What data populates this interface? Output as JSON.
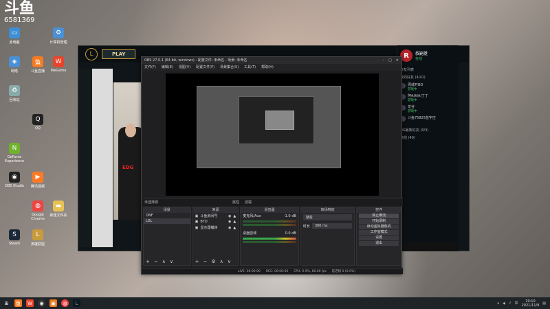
{
  "watermark": {
    "logo": "斗鱼",
    "room": "6581369"
  },
  "desktop_icons": [
    {
      "label": "此电脑",
      "icon": "computer-icon",
      "color": "#3f8fd6",
      "glyph": "▭"
    },
    {
      "label": "计算机管理",
      "icon": "gear-icon",
      "color": "#4a90d6",
      "glyph": "⚙"
    },
    {
      "label": "网络",
      "icon": "network-icon",
      "color": "#4a90d6",
      "glyph": "◈"
    },
    {
      "label": "斗鱼直播",
      "icon": "douyu-icon",
      "color": "#f57b22",
      "glyph": "鱼"
    },
    {
      "label": "WeGame",
      "icon": "wegame-icon",
      "color": "#e8442b",
      "glyph": "W"
    },
    {
      "label": "回收站",
      "icon": "recycle-bin-icon",
      "color": "#8aa",
      "glyph": "♻"
    },
    {
      "label": "QQ",
      "icon": "qq-icon",
      "color": "#222",
      "glyph": "Q"
    },
    {
      "label": "GeForce Experience",
      "icon": "nvidia-icon",
      "color": "#6fb22c",
      "glyph": "N"
    },
    {
      "label": "OBS Studio",
      "icon": "obs-icon",
      "color": "#222",
      "glyph": "◉"
    },
    {
      "label": "腾讯视频",
      "icon": "tencent-video-icon",
      "color": "#ff7a22",
      "glyph": "▶"
    },
    {
      "label": "Google Chrome",
      "icon": "chrome-icon",
      "color": "#e44",
      "glyph": "◍"
    },
    {
      "label": "新建文件夹",
      "icon": "folder-icon",
      "color": "#e8c155",
      "glyph": "▬"
    },
    {
      "label": "Steam",
      "icon": "steam-icon",
      "color": "#1b2838",
      "glyph": "S"
    },
    {
      "label": "英雄联盟",
      "icon": "lol-icon",
      "color": "#c89b3c",
      "glyph": "L"
    }
  ],
  "client": {
    "play_label": "PLAY",
    "logo": "L",
    "player_team": "EDG"
  },
  "chat": {
    "avatar": "R",
    "name": "叔嗣挺",
    "status": "在线",
    "header": "好友列表",
    "group1": "我的好友 (4/41)",
    "friends": [
      {
        "name": "周城开BO",
        "status": "游戏中"
      },
      {
        "name": "阿纠纠纠丁丁",
        "status": "游戏中"
      },
      {
        "name": "龙谷",
        "status": "游戏中"
      },
      {
        "name": "斗鱼75825蓝宇庄",
        "status": ""
      }
    ],
    "group2": "OG最新好友 (0/3)",
    "group3": "离线 (49)"
  },
  "obs": {
    "title": "OBS 27.0.1 (64-bit, windows) - 配置文件: 未命名 - 场景: 未命名",
    "menu": [
      "文件(F)",
      "编辑(E)",
      "视图(V)",
      "配置文件(P)",
      "场景集合(S)",
      "工具(T)",
      "帮助(H)"
    ],
    "tabs": [
      "未选择源",
      "属性",
      "滤镜"
    ],
    "scenes_header": "场景",
    "scenes": [
      "DNF",
      "LOL"
    ],
    "sources_header": "来源",
    "sources": [
      "斗鱼房间号",
      "BTD",
      "显示器捕获"
    ],
    "mixer_header": "混音器",
    "mixer": [
      {
        "name": "麦克风/Aux",
        "db": "-1.0 dB"
      },
      {
        "name": "桌面音频",
        "db": "0.0 dB"
      }
    ],
    "transition_header": "转场特效",
    "transition": {
      "type": "渐变",
      "duration_label": "时长",
      "duration": "300 ms"
    },
    "controls_header": "控件",
    "controls": [
      "停止推流",
      "开始录制",
      "启动虚拟摄像机",
      "工作室模式",
      "设置",
      "退出"
    ],
    "status": {
      "live": "LIVE: 00:00:00",
      "rec": "REC: 00:00:00",
      "cpu": "CPU: 0.9%, 60.00 fps",
      "dropped": "延迟帧 0 (0.0%)"
    }
  },
  "taskbar": {
    "time": "19:10",
    "date": "2021/11/9",
    "lang": "中"
  }
}
